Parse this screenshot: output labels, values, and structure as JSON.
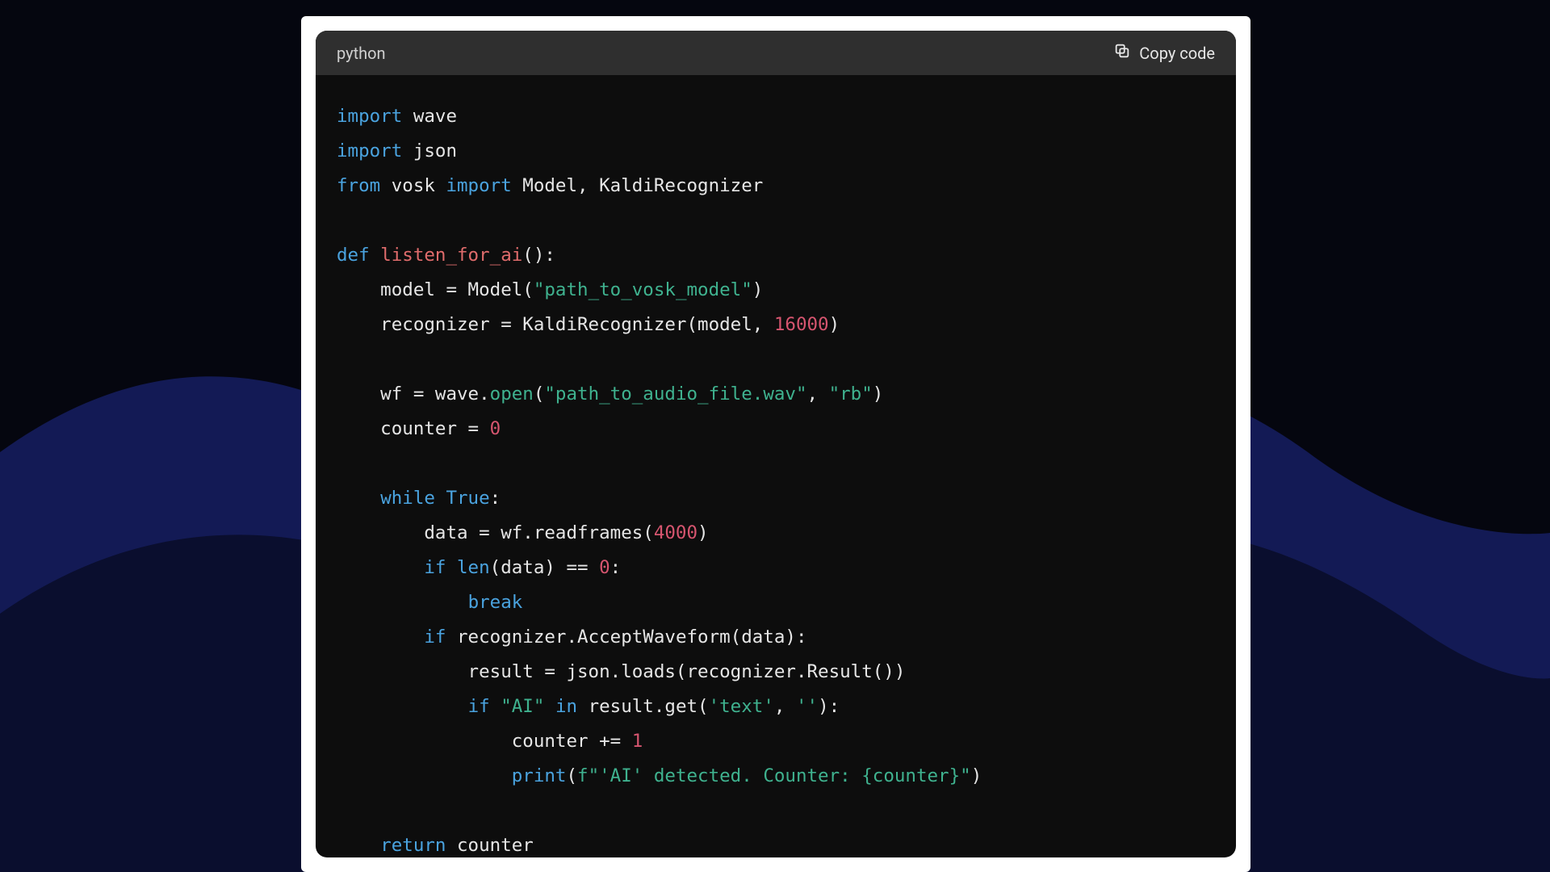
{
  "header": {
    "language_label": "python",
    "copy_label": "Copy code"
  },
  "code": {
    "tokens": [
      [
        {
          "c": "k",
          "t": "import"
        },
        {
          "c": "txt",
          "t": " wave"
        }
      ],
      [
        {
          "c": "k",
          "t": "import"
        },
        {
          "c": "txt",
          "t": " json"
        }
      ],
      [
        {
          "c": "k",
          "t": "from"
        },
        {
          "c": "txt",
          "t": " vosk "
        },
        {
          "c": "k",
          "t": "import"
        },
        {
          "c": "txt",
          "t": " Model, KaldiRecognizer"
        }
      ],
      [],
      [
        {
          "c": "k",
          "t": "def"
        },
        {
          "c": "txt",
          "t": " "
        },
        {
          "c": "fn",
          "t": "listen_for_ai"
        },
        {
          "c": "txt",
          "t": "():"
        }
      ],
      [
        {
          "c": "txt",
          "t": "    model = Model("
        },
        {
          "c": "str",
          "t": "\"path_to_vosk_model\""
        },
        {
          "c": "txt",
          "t": ")"
        }
      ],
      [
        {
          "c": "txt",
          "t": "    recognizer = KaldiRecognizer(model, "
        },
        {
          "c": "num",
          "t": "16000"
        },
        {
          "c": "txt",
          "t": ")"
        }
      ],
      [],
      [
        {
          "c": "txt",
          "t": "    wf = wave."
        },
        {
          "c": "call",
          "t": "open"
        },
        {
          "c": "txt",
          "t": "("
        },
        {
          "c": "str",
          "t": "\"path_to_audio_file.wav\""
        },
        {
          "c": "txt",
          "t": ", "
        },
        {
          "c": "str",
          "t": "\"rb\""
        },
        {
          "c": "txt",
          "t": ")"
        }
      ],
      [
        {
          "c": "txt",
          "t": "    counter = "
        },
        {
          "c": "num",
          "t": "0"
        }
      ],
      [],
      [
        {
          "c": "txt",
          "t": "    "
        },
        {
          "c": "k",
          "t": "while"
        },
        {
          "c": "txt",
          "t": " "
        },
        {
          "c": "k",
          "t": "True"
        },
        {
          "c": "txt",
          "t": ":"
        }
      ],
      [
        {
          "c": "txt",
          "t": "        data = wf.readframes("
        },
        {
          "c": "num",
          "t": "4000"
        },
        {
          "c": "txt",
          "t": ")"
        }
      ],
      [
        {
          "c": "txt",
          "t": "        "
        },
        {
          "c": "k",
          "t": "if"
        },
        {
          "c": "txt",
          "t": " "
        },
        {
          "c": "bi",
          "t": "len"
        },
        {
          "c": "txt",
          "t": "(data) == "
        },
        {
          "c": "num",
          "t": "0"
        },
        {
          "c": "txt",
          "t": ":"
        }
      ],
      [
        {
          "c": "txt",
          "t": "            "
        },
        {
          "c": "k",
          "t": "break"
        }
      ],
      [
        {
          "c": "txt",
          "t": "        "
        },
        {
          "c": "k",
          "t": "if"
        },
        {
          "c": "txt",
          "t": " recognizer.AcceptWaveform(data):"
        }
      ],
      [
        {
          "c": "txt",
          "t": "            result = json.loads(recognizer.Result())"
        }
      ],
      [
        {
          "c": "txt",
          "t": "            "
        },
        {
          "c": "k",
          "t": "if"
        },
        {
          "c": "txt",
          "t": " "
        },
        {
          "c": "str",
          "t": "\"AI\""
        },
        {
          "c": "txt",
          "t": " "
        },
        {
          "c": "k",
          "t": "in"
        },
        {
          "c": "txt",
          "t": " result.get("
        },
        {
          "c": "str",
          "t": "'text'"
        },
        {
          "c": "txt",
          "t": ", "
        },
        {
          "c": "str",
          "t": "''"
        },
        {
          "c": "txt",
          "t": "):"
        }
      ],
      [
        {
          "c": "txt",
          "t": "                counter += "
        },
        {
          "c": "num",
          "t": "1"
        }
      ],
      [
        {
          "c": "txt",
          "t": "                "
        },
        {
          "c": "bi",
          "t": "print"
        },
        {
          "c": "txt",
          "t": "("
        },
        {
          "c": "str",
          "t": "f\"'AI' detected. Counter: {counter}\""
        },
        {
          "c": "txt",
          "t": ")"
        }
      ],
      [],
      [
        {
          "c": "txt",
          "t": "    "
        },
        {
          "c": "k",
          "t": "return"
        },
        {
          "c": "txt",
          "t": " counter"
        }
      ]
    ]
  }
}
